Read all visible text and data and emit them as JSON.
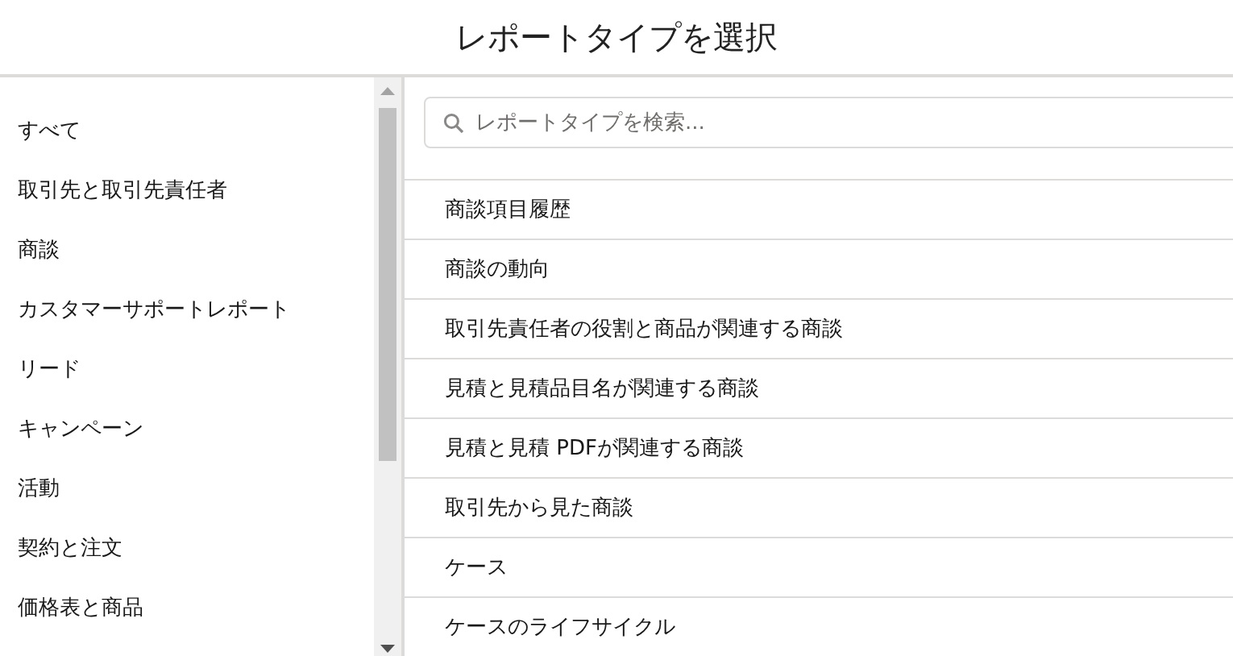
{
  "title": "レポートタイプを選択",
  "categories": [
    {
      "label": "すべて"
    },
    {
      "label": "取引先と取引先責任者"
    },
    {
      "label": "商談"
    },
    {
      "label": "カスタマーサポートレポート"
    },
    {
      "label": "リード"
    },
    {
      "label": "キャンペーン"
    },
    {
      "label": "活動"
    },
    {
      "label": "契約と注文"
    },
    {
      "label": "価格表と商品"
    }
  ],
  "search": {
    "placeholder": "レポートタイプを検索..."
  },
  "report_types": [
    {
      "label": "商談項目履歴"
    },
    {
      "label": "商談の動向"
    },
    {
      "label": "取引先責任者の役割と商品が関連する商談"
    },
    {
      "label": "見積と見積品目名が関連する商談"
    },
    {
      "label": "見積と見積 PDFが関連する商談"
    },
    {
      "label": "取引先から見た商談"
    },
    {
      "label": "ケース"
    },
    {
      "label": "ケースのライフサイクル"
    }
  ]
}
